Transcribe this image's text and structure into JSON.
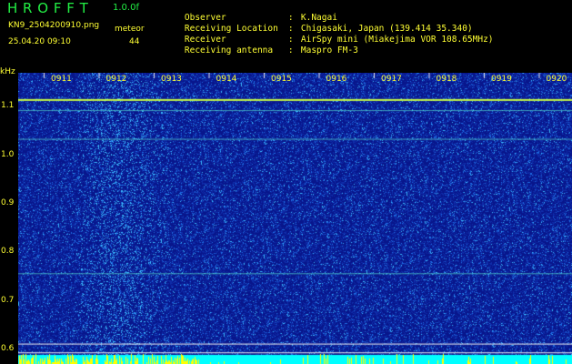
{
  "header": {
    "app_title": "H R O F F T",
    "version": "1.0.0f",
    "filename": "KN9_2504200910.png",
    "datetime": "25.04.20 09:10",
    "meteor_label": "meteor",
    "meteor_count": "44"
  },
  "info": [
    {
      "key": "Observer",
      "sep": ":",
      "value": "K.Nagai"
    },
    {
      "key": "Receiving Location",
      "sep": ":",
      "value": "Chigasaki, Japan (139.414 35.340)"
    },
    {
      "key": "Receiver",
      "sep": ":",
      "value": "AirSpy mini (Miakejima VOR 108.65MHz)"
    },
    {
      "key": "Receiving antenna",
      "sep": ":",
      "value": "Maspro FM-3"
    }
  ],
  "chart_data": {
    "type": "heatmap",
    "ylabel": "kHz",
    "y_ticks": [
      "1.1",
      "1.0",
      "0.9",
      "0.8",
      "0.7",
      "0.6"
    ],
    "y_tick_values": [
      1.1,
      1.0,
      0.9,
      0.8,
      0.7,
      0.6
    ],
    "x_ticks": [
      "0911",
      "0912",
      "0913",
      "0914",
      "0915",
      "0916",
      "0917",
      "0918",
      "0919",
      "0920"
    ],
    "ylim": [
      0.57,
      1.17
    ],
    "xlim_minutes": [
      0,
      10
    ],
    "horizontal_lines_khz": [
      1.114,
      1.093,
      1.034,
      0.757,
      0.612,
      0.594
    ],
    "carrier_line_khz": 1.114,
    "colors": {
      "background": "#0a1a9a",
      "noise_bright": "#33aaff",
      "carrier": "#ccff44",
      "bottom_band": "#00ffff",
      "bottom_peaks": "#ffff00",
      "labels": "#ffff33",
      "gridline": "#f0f0f0"
    }
  }
}
